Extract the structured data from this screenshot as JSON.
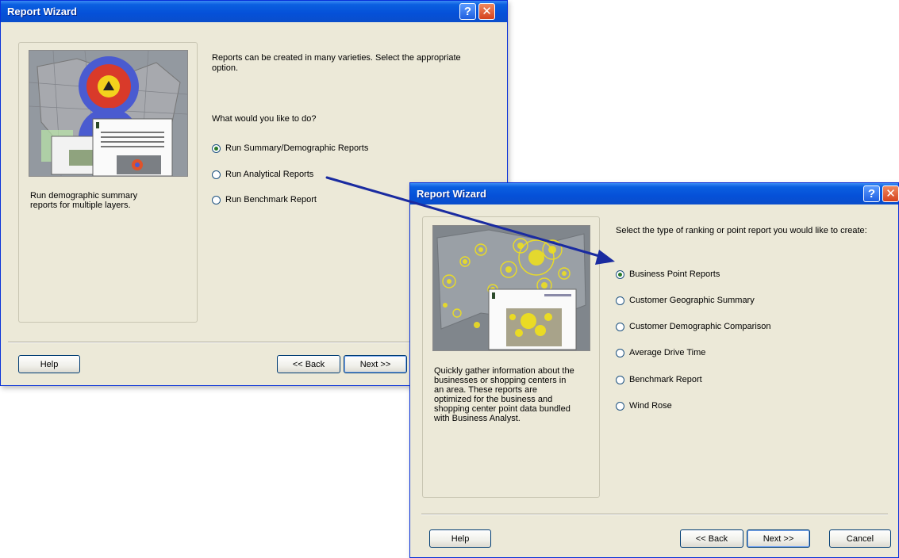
{
  "dialog1": {
    "title": "Report Wizard",
    "intro": "Reports can be created in many varieties. Select the appropriate option.",
    "question": "What would you like to do?",
    "options": [
      {
        "label": "Run Summary/Demographic Reports",
        "selected": true
      },
      {
        "label": "Run Analytical Reports",
        "selected": false
      },
      {
        "label": "Run Benchmark Report",
        "selected": false
      }
    ],
    "description": "Run demographic summary reports for multiple layers.",
    "buttons": {
      "help": "Help",
      "back": "<< Back",
      "next": "Next >>"
    }
  },
  "dialog2": {
    "title": "Report Wizard",
    "intro": "Select the type of ranking or point report you would like to create:",
    "options": [
      {
        "label": "Business Point Reports",
        "selected": true
      },
      {
        "label": "Customer Geographic Summary",
        "selected": false
      },
      {
        "label": "Customer  Demographic Comparison",
        "selected": false
      },
      {
        "label": "Average Drive Time",
        "selected": false
      },
      {
        "label": "Benchmark Report",
        "selected": false
      },
      {
        "label": "Wind Rose",
        "selected": false
      }
    ],
    "description": "Quickly gather information about the businesses or shopping centers in an area. These reports are optimized for the business and shopping center point data bundled with Business Analyst.",
    "buttons": {
      "help": "Help",
      "back": "<< Back",
      "next": "Next >>",
      "cancel": "Cancel"
    }
  },
  "colors": {
    "titlebar": "#0550D8",
    "dialog_bg": "#ECE9D8",
    "arrow": "#1A2BA0",
    "highlight": "#F2E21A"
  }
}
